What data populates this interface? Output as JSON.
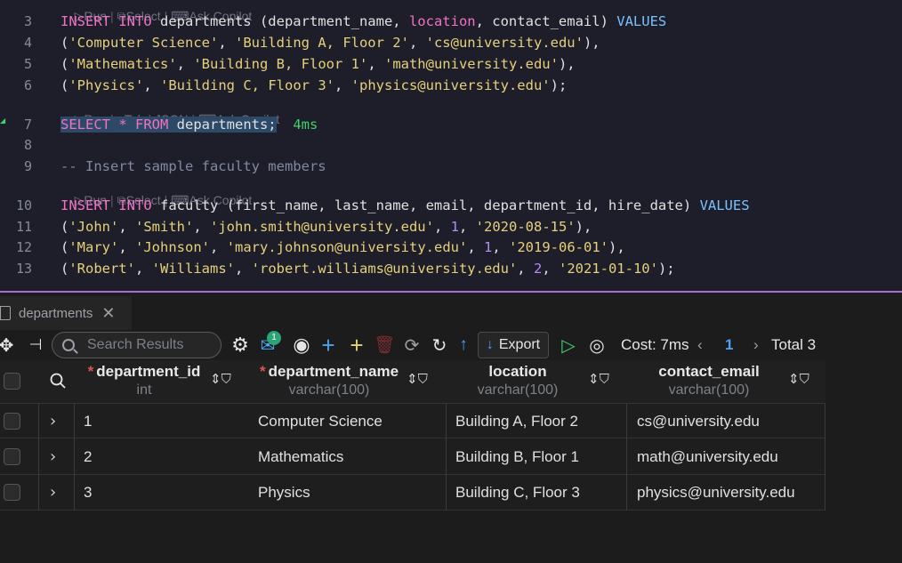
{
  "editor": {
    "codelens_1": {
      "run": "Run",
      "select": "Select",
      "copilot": "Ask Copilot"
    },
    "codelens_2": {
      "run": "Run",
      "tab": "Tab",
      "json": "JSON",
      "copilot": "Ask Copilot"
    },
    "codelens_3": {
      "run": "Run",
      "select": "Select",
      "copilot": "Ask Copilot"
    },
    "lines": {
      "l3": {
        "num": "3",
        "t1": "INSERT INTO",
        "t2": " departments (department_name, ",
        "t3": "location",
        "t4": ", contact_email) ",
        "t5": "VALUES"
      },
      "l4": {
        "num": "4",
        "t1": "(",
        "t2": "'Computer Science'",
        "t3": ", ",
        "t4": "'Building A, Floor 2'",
        "t5": ", ",
        "t6": "'cs@university.edu'",
        "t7": "),"
      },
      "l5": {
        "num": "5",
        "t1": "(",
        "t2": "'Mathematics'",
        "t3": ", ",
        "t4": "'Building B, Floor 1'",
        "t5": ", ",
        "t6": "'math@university.edu'",
        "t7": "),"
      },
      "l6": {
        "num": "6",
        "t1": "(",
        "t2": "'Physics'",
        "t3": ", ",
        "t4": "'Building C, Floor 3'",
        "t5": ", ",
        "t6": "'physics@university.edu'",
        "t7": ");"
      },
      "l7": {
        "num": "7",
        "t1": "SELECT * FROM",
        "t2": " departments;",
        "t3": "4ms"
      },
      "l8": {
        "num": "8"
      },
      "l9": {
        "num": "9",
        "t1": "-- Insert sample faculty members"
      },
      "l10": {
        "num": "10",
        "t1": "INSERT INTO",
        "t2": " faculty (first_name, last_name, email, department_id, hire_date) ",
        "t3": "VALUES"
      },
      "l11": {
        "num": "11",
        "t1": "(",
        "t2": "'John'",
        "t3": ", ",
        "t4": "'Smith'",
        "t5": ", ",
        "t6": "'john.smith@university.edu'",
        "t7": ", ",
        "t8": "1",
        "t9": ", ",
        "t10": "'2020-08-15'",
        "t11": "),"
      },
      "l12": {
        "num": "12",
        "t1": "(",
        "t2": "'Mary'",
        "t3": ", ",
        "t4": "'Johnson'",
        "t5": ", ",
        "t6": "'mary.johnson@university.edu'",
        "t7": ", ",
        "t8": "1",
        "t9": ", ",
        "t10": "'2019-06-01'",
        "t11": "),"
      },
      "l13": {
        "num": "13",
        "t1": "(",
        "t2": "'Robert'",
        "t3": ", ",
        "t4": "'Williams'",
        "t5": ", ",
        "t6": "'robert.williams@university.edu'",
        "t7": ", ",
        "t8": "2",
        "t9": ", ",
        "t10": "'2021-01-10'",
        "t11": ");"
      }
    }
  },
  "panel": {
    "tab_label": "departments",
    "search_placeholder": "Search Results",
    "badge_count": "1",
    "export_label": "Export",
    "cost": "Cost: 7ms",
    "page": "1",
    "total": "Total 3"
  },
  "table": {
    "columns": [
      {
        "name": "department_id",
        "type": "int",
        "required": true
      },
      {
        "name": "department_name",
        "type": "varchar(100)",
        "required": true
      },
      {
        "name": "location",
        "type": "varchar(100)",
        "required": false
      },
      {
        "name": "contact_email",
        "type": "varchar(100)",
        "required": false
      }
    ],
    "rows": [
      [
        "1",
        "Computer Science",
        "Building A, Floor 2",
        "cs@university.edu"
      ],
      [
        "2",
        "Mathematics",
        "Building B, Floor 1",
        "math@university.edu"
      ],
      [
        "3",
        "Physics",
        "Building C, Floor 3",
        "physics@university.edu"
      ]
    ]
  },
  "colors": {
    "accent": "#a36fcf",
    "keyword": "#f072c5",
    "string": "#e5d17a",
    "number": "#b48cf2",
    "success": "#3fd16a"
  }
}
